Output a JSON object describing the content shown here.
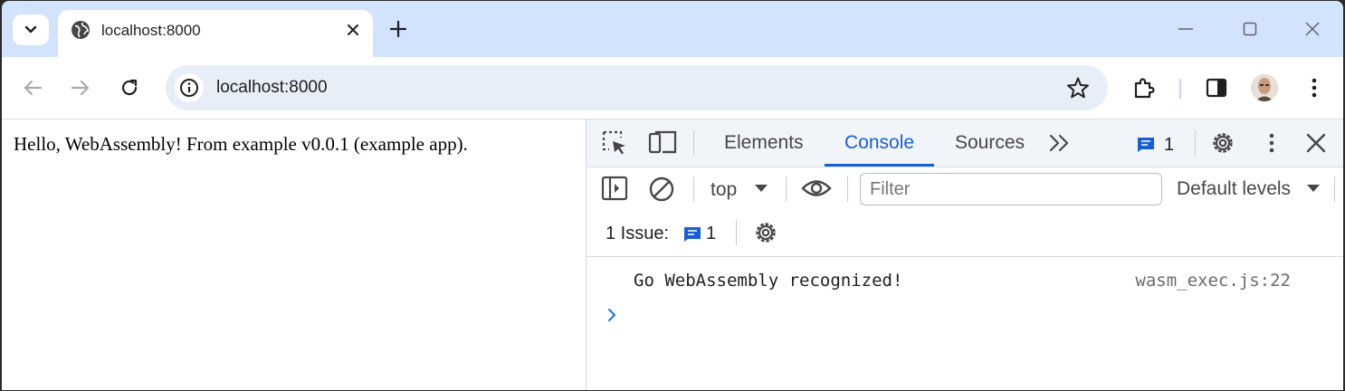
{
  "colors": {
    "tabstrip_bg": "#d3e3fd",
    "accent": "#1a5fd0",
    "omnibox_bg": "#e8eef7",
    "icon": "#474747"
  },
  "browser": {
    "tab": {
      "title": "localhost:8000",
      "icon": "globe-icon"
    },
    "omnibox": {
      "url": "localhost:8000"
    }
  },
  "page": {
    "text": "Hello, WebAssembly! From example v0.0.1 (example app)."
  },
  "devtools": {
    "tabs": [
      {
        "label": "Elements",
        "active": false
      },
      {
        "label": "Console",
        "active": true
      },
      {
        "label": "Sources",
        "active": false
      }
    ],
    "message_count": "1",
    "toolbar": {
      "context": "top",
      "filter_placeholder": "Filter",
      "levels": "Default levels"
    },
    "issues": {
      "label": "1 Issue:",
      "count": "1"
    },
    "console": {
      "messages": [
        {
          "text": "Go WebAssembly recognized!",
          "source": "wasm_exec.js:22"
        }
      ]
    }
  }
}
